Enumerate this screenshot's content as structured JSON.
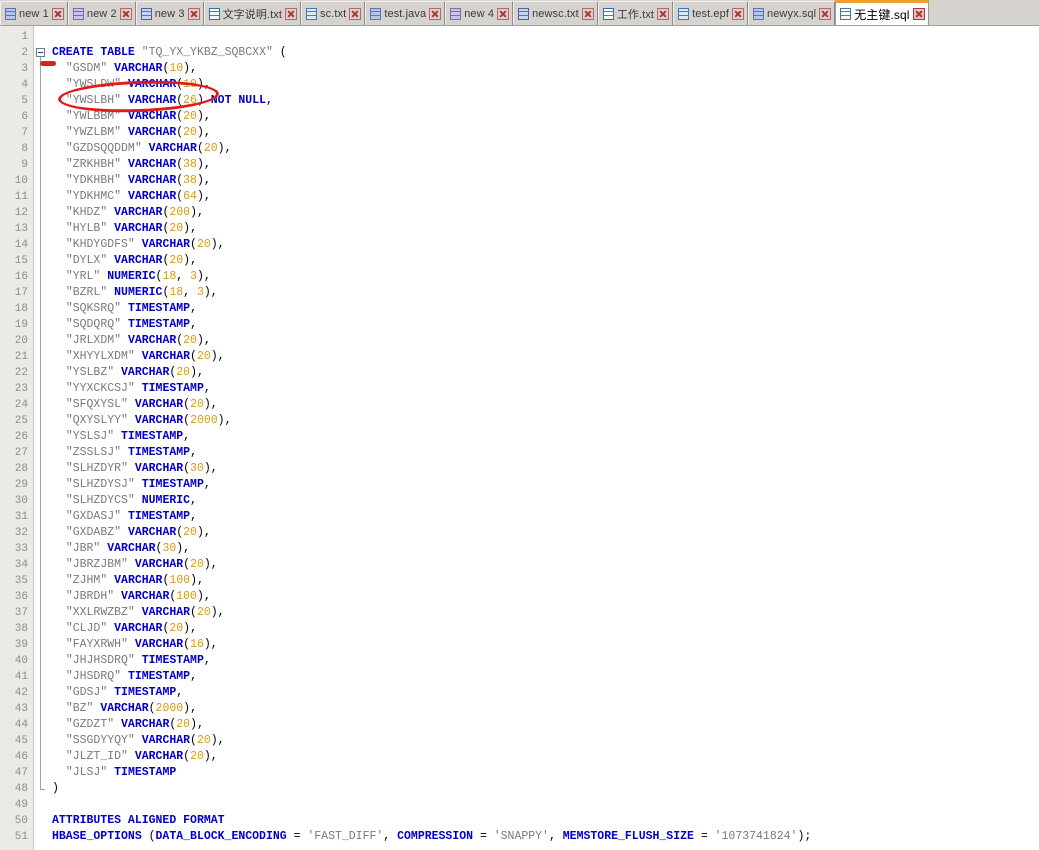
{
  "window": {
    "app_kind": "text-editor",
    "accent_color": "#f0a030",
    "tabbar_bg": "#d6d3ce",
    "editor_bg": "#ffffff",
    "gutter_bg": "#eceae6",
    "annotation_color": "#e01b1b"
  },
  "tabs": [
    {
      "label": "new 1",
      "icon": "document-icon",
      "active": false
    },
    {
      "label": "new 2",
      "icon": "document-icon",
      "active": false
    },
    {
      "label": "new 3",
      "icon": "document-icon",
      "active": false
    },
    {
      "label": "文字说明.txt",
      "icon": "document-icon",
      "active": false
    },
    {
      "label": "sc.txt",
      "icon": "document-icon",
      "active": false
    },
    {
      "label": "test.java",
      "icon": "document-icon",
      "active": false
    },
    {
      "label": "new 4",
      "icon": "document-icon",
      "active": false
    },
    {
      "label": "newsc.txt",
      "icon": "document-icon",
      "active": false
    },
    {
      "label": "工作.txt",
      "icon": "document-icon",
      "active": false
    },
    {
      "label": "test.epf",
      "icon": "document-icon",
      "active": false
    },
    {
      "label": "newyx.sql",
      "icon": "document-icon",
      "active": false
    },
    {
      "label": "无主键.sql",
      "icon": "document-icon",
      "active": true
    }
  ],
  "close_icon": "close-icon",
  "editor": {
    "first_line_number": 1,
    "last_line_number": 51,
    "fold_marker_line": 2,
    "annotations": [
      {
        "kind": "red-dash-marker",
        "line": 1
      },
      {
        "kind": "red-ellipse",
        "line": 3,
        "targets": "VARCHAR(10),"
      }
    ],
    "lines": [
      {
        "n": 1,
        "text": ""
      },
      {
        "n": 2,
        "text": "CREATE TABLE \"TQ_YX_YKBZ_SQBCXX\" ("
      },
      {
        "n": 3,
        "text": "  \"GSDM\" VARCHAR(10),"
      },
      {
        "n": 4,
        "text": "  \"YWSLDW\" VARCHAR(10),"
      },
      {
        "n": 5,
        "text": "  \"YWSLBH\" VARCHAR(26) NOT NULL,"
      },
      {
        "n": 6,
        "text": "  \"YWLBBM\" VARCHAR(20),"
      },
      {
        "n": 7,
        "text": "  \"YWZLBM\" VARCHAR(20),"
      },
      {
        "n": 8,
        "text": "  \"GZDSQQDDM\" VARCHAR(20),"
      },
      {
        "n": 9,
        "text": "  \"ZRKHBH\" VARCHAR(38),"
      },
      {
        "n": 10,
        "text": "  \"YDKHBH\" VARCHAR(38),"
      },
      {
        "n": 11,
        "text": "  \"YDKHMC\" VARCHAR(64),"
      },
      {
        "n": 12,
        "text": "  \"KHDZ\" VARCHAR(200),"
      },
      {
        "n": 13,
        "text": "  \"HYLB\" VARCHAR(20),"
      },
      {
        "n": 14,
        "text": "  \"KHDYGDFS\" VARCHAR(20),"
      },
      {
        "n": 15,
        "text": "  \"DYLX\" VARCHAR(20),"
      },
      {
        "n": 16,
        "text": "  \"YRL\" NUMERIC(18, 3),"
      },
      {
        "n": 17,
        "text": "  \"BZRL\" NUMERIC(18, 3),"
      },
      {
        "n": 18,
        "text": "  \"SQKSRQ\" TIMESTAMP,"
      },
      {
        "n": 19,
        "text": "  \"SQDQRQ\" TIMESTAMP,"
      },
      {
        "n": 20,
        "text": "  \"JRLXDM\" VARCHAR(20),"
      },
      {
        "n": 21,
        "text": "  \"XHYYLXDM\" VARCHAR(20),"
      },
      {
        "n": 22,
        "text": "  \"YSLBZ\" VARCHAR(20),"
      },
      {
        "n": 23,
        "text": "  \"YYXCKCSJ\" TIMESTAMP,"
      },
      {
        "n": 24,
        "text": "  \"SFQXYSL\" VARCHAR(20),"
      },
      {
        "n": 25,
        "text": "  \"QXYSLYY\" VARCHAR(2000),"
      },
      {
        "n": 26,
        "text": "  \"YSLSJ\" TIMESTAMP,"
      },
      {
        "n": 27,
        "text": "  \"ZSSLSJ\" TIMESTAMP,"
      },
      {
        "n": 28,
        "text": "  \"SLHZDYR\" VARCHAR(30),"
      },
      {
        "n": 29,
        "text": "  \"SLHZDYSJ\" TIMESTAMP,"
      },
      {
        "n": 30,
        "text": "  \"SLHZDYCS\" NUMERIC,"
      },
      {
        "n": 31,
        "text": "  \"GXDASJ\" TIMESTAMP,"
      },
      {
        "n": 32,
        "text": "  \"GXDABZ\" VARCHAR(20),"
      },
      {
        "n": 33,
        "text": "  \"JBR\" VARCHAR(30),"
      },
      {
        "n": 34,
        "text": "  \"JBRZJBM\" VARCHAR(20),"
      },
      {
        "n": 35,
        "text": "  \"ZJHM\" VARCHAR(100),"
      },
      {
        "n": 36,
        "text": "  \"JBRDH\" VARCHAR(100),"
      },
      {
        "n": 37,
        "text": "  \"XXLRWZBZ\" VARCHAR(20),"
      },
      {
        "n": 38,
        "text": "  \"CLJD\" VARCHAR(20),"
      },
      {
        "n": 39,
        "text": "  \"FAYXRWH\" VARCHAR(16),"
      },
      {
        "n": 40,
        "text": "  \"JHJHSDRQ\" TIMESTAMP,"
      },
      {
        "n": 41,
        "text": "  \"JHSDRQ\" TIMESTAMP,"
      },
      {
        "n": 42,
        "text": "  \"GDSJ\" TIMESTAMP,"
      },
      {
        "n": 43,
        "text": "  \"BZ\" VARCHAR(2000),"
      },
      {
        "n": 44,
        "text": "  \"GZDZT\" VARCHAR(20),"
      },
      {
        "n": 45,
        "text": "  \"SSGDYYQY\" VARCHAR(20),"
      },
      {
        "n": 46,
        "text": "  \"JLZT_ID\" VARCHAR(20),"
      },
      {
        "n": 47,
        "text": "  \"JLSJ\" TIMESTAMP"
      },
      {
        "n": 48,
        "text": ")"
      },
      {
        "n": 49,
        "text": ""
      },
      {
        "n": 50,
        "text": "ATTRIBUTES ALIGNED FORMAT"
      },
      {
        "n": 51,
        "text": "HBASE_OPTIONS (DATA_BLOCK_ENCODING = 'FAST_DIFF', COMPRESSION = 'SNAPPY', MEMSTORE_FLUSH_SIZE = '1073741824');"
      }
    ],
    "keywords": [
      "CREATE",
      "TABLE",
      "VARCHAR",
      "NUMERIC",
      "TIMESTAMP",
      "NOT",
      "NULL",
      "ATTRIBUTES",
      "ALIGNED",
      "FORMAT",
      "HBASE_OPTIONS",
      "DATA_BLOCK_ENCODING",
      "COMPRESSION",
      "MEMSTORE_FLUSH_SIZE"
    ],
    "colors": {
      "keyword": "#0000c8",
      "string": "#7a7a7a",
      "number": "#d49b16",
      "text": "#000000",
      "line_number": "#8d8d8d"
    }
  }
}
